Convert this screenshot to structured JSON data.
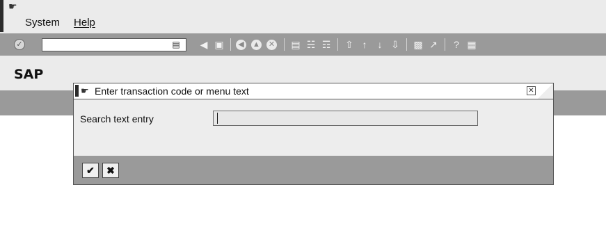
{
  "menubar": {
    "items": [
      "System",
      "Help"
    ]
  },
  "toolbar": {
    "command_field_value": "",
    "icons": [
      "enter-icon",
      "dropdown-icon",
      "back-triangle-icon",
      "save-icon",
      "back-icon",
      "exit-icon",
      "cancel-icon",
      "print-icon",
      "find-icon",
      "find-next-icon",
      "first-page-icon",
      "previous-page-icon",
      "next-page-icon",
      "last-page-icon",
      "create-session-icon",
      "shortcut-icon",
      "help-icon",
      "layout-menu-icon"
    ]
  },
  "screen": {
    "title": "SAP"
  },
  "dialog": {
    "title": "Enter transaction code or menu text",
    "field_label": "Search text entry",
    "field_value": "",
    "buttons": [
      "continue-checkmark-icon",
      "cancel-x-icon"
    ]
  }
}
